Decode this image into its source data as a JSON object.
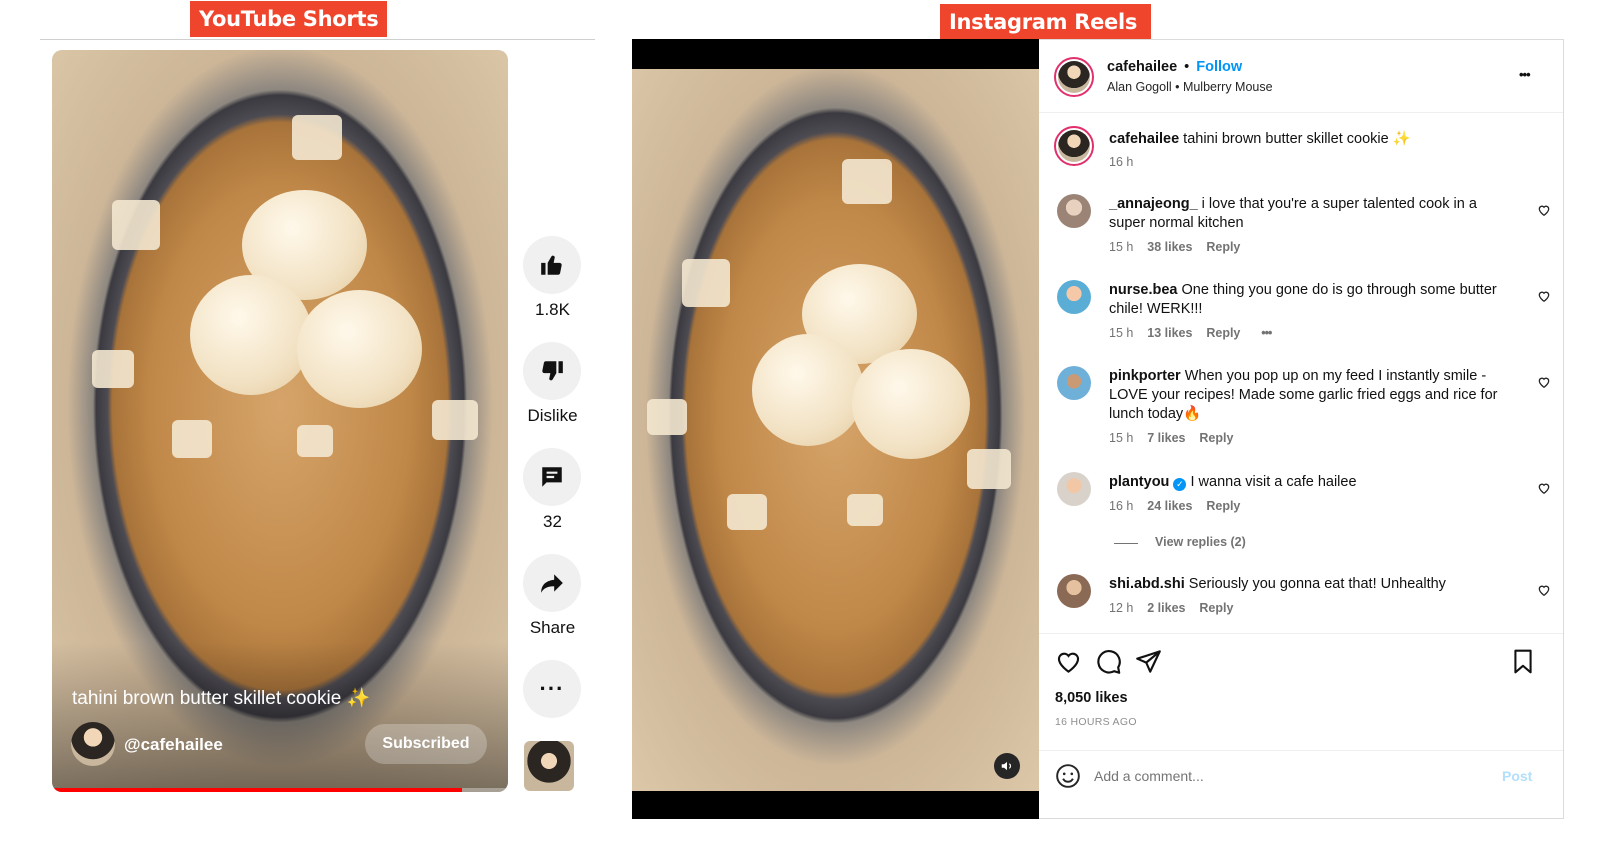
{
  "labels": {
    "left": "YouTube Shorts",
    "right": "Instagram Reels"
  },
  "youtube": {
    "title": "tahini brown butter skillet cookie ✨",
    "channel": "@cafehailee",
    "subscribe_label": "Subscribed",
    "actions": [
      {
        "icon": "thumbs-up-icon",
        "label": "1.8K"
      },
      {
        "icon": "thumbs-down-icon",
        "label": "Dislike"
      },
      {
        "icon": "comment-icon",
        "label": "32"
      },
      {
        "icon": "share-icon",
        "label": "Share"
      },
      {
        "icon": "more-icon",
        "label": ""
      }
    ],
    "progress": 0.9,
    "accent": "#ff0000"
  },
  "instagram": {
    "header": {
      "username": "cafehailee",
      "follow": "Follow",
      "separator": "•",
      "audio": "Alan Gogoll • Mulberry Mouse",
      "more": "•••"
    },
    "caption": {
      "username": "cafehailee",
      "text": "tahini brown butter skillet cookie ✨",
      "time": "16 h"
    },
    "comments": [
      {
        "username": "_annajeong_",
        "text": "i love that you're a super talented cook in a super normal kitchen",
        "time": "15 h",
        "likes": "38 likes",
        "reply": "Reply"
      },
      {
        "username": "nurse.bea",
        "text": "One thing you gone do is go through some butter chile! WERK!!!",
        "time": "15 h",
        "likes": "13 likes",
        "reply": "Reply",
        "more": "•••"
      },
      {
        "username": "pinkporter",
        "text": "When you pop up on my feed I instantly smile - LOVE your recipes! Made some garlic fried eggs and rice for lunch today🔥",
        "time": "15 h",
        "likes": "7 likes",
        "reply": "Reply"
      },
      {
        "username": "plantyou",
        "verified": true,
        "text": "I wanna visit a cafe hailee",
        "time": "16 h",
        "likes": "24 likes",
        "reply": "Reply",
        "view_replies": "View replies (2)"
      },
      {
        "username": "shi.abd.shi",
        "text": "Seriously you gonna eat that! Unhealthy",
        "time": "12 h",
        "likes": "2 likes",
        "reply": "Reply"
      }
    ],
    "likes_count": "8,050 likes",
    "posted": "16 HOURS AGO",
    "comment_placeholder": "Add a comment...",
    "post_label": "Post",
    "accent": "#0095f6"
  }
}
